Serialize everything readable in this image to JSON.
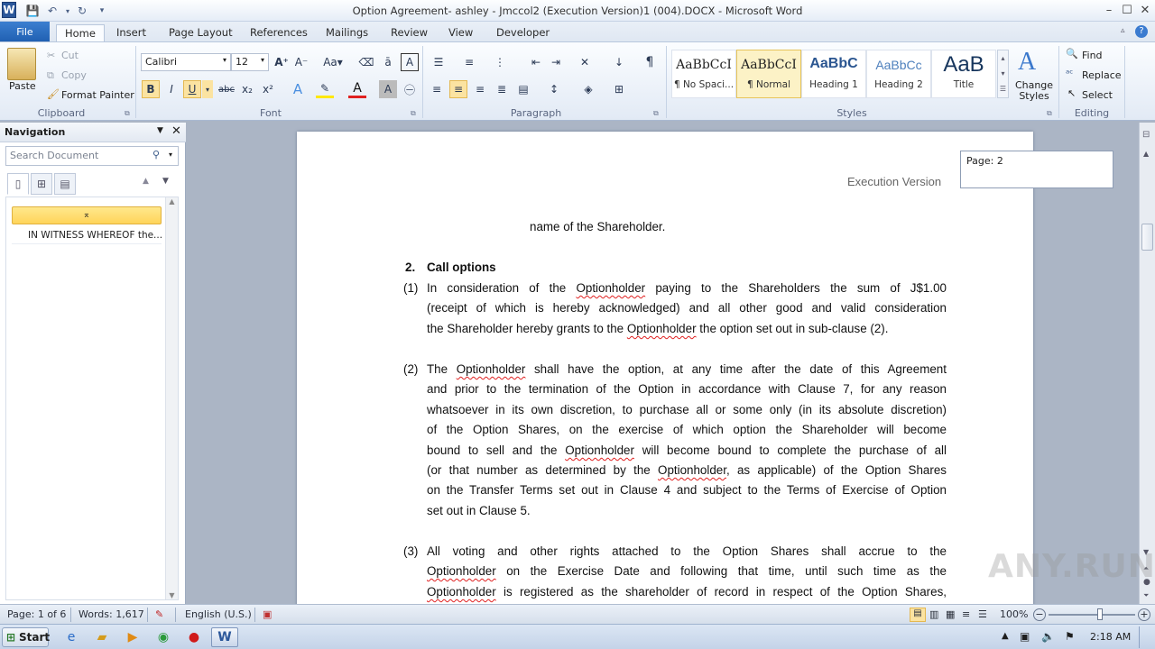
{
  "titlebar": {
    "title": "Option Agreement- ashley - Jmccol2 (Execution Version)1 (004).DOCX  -  Microsoft Word",
    "app_icon": "word-icon",
    "minimize": "–",
    "maximize": "☐",
    "close": "✕"
  },
  "tabs": [
    "File",
    "Home",
    "Insert",
    "Page Layout",
    "References",
    "Mailings",
    "Review",
    "View",
    "Developer"
  ],
  "clipboard": {
    "paste": "Paste",
    "cut": "Cut",
    "copy": "Copy",
    "format_painter": "Format Painter",
    "label": "Clipboard"
  },
  "font": {
    "name": "Calibri",
    "size": "12",
    "label": "Font",
    "bold": "B",
    "italic": "I",
    "underline": "U",
    "strike": "abc",
    "subscript": "x₂",
    "superscript": "x²"
  },
  "paragraph": {
    "label": "Paragraph",
    "pilcrow": "¶"
  },
  "styles": {
    "label": "Styles",
    "items": [
      {
        "preview": "AaBbCcI",
        "name": "¶ No Spaci..."
      },
      {
        "preview": "AaBbCcI",
        "name": "¶ Normal"
      },
      {
        "preview": "AaBbC",
        "name": "Heading 1"
      },
      {
        "preview": "AaBbCc",
        "name": "Heading 2"
      },
      {
        "preview": "AaB",
        "name": "Title"
      }
    ],
    "change_styles": "Change Styles"
  },
  "editing": {
    "label": "Editing",
    "find": "Find",
    "replace": "Replace",
    "select": "Select"
  },
  "nav": {
    "title": "Navigation",
    "search_placeholder": "Search Document",
    "item": "IN WITNESS WHEREOF the..."
  },
  "doc": {
    "header": "Execution Version",
    "line0": "name of the Shareholder.",
    "heading_num": "2.",
    "heading": "Call options",
    "p1_num": "(1)",
    "p1": [
      "In consideration of the",
      "Optionholder",
      "paying to the Shareholders the sum of J$1.00",
      "(receipt of which is hereby acknowledged) and all other good and valid consideration",
      "the Shareholder hereby grants to the",
      "Optionholder",
      "the option set out in sub-clause (2)."
    ],
    "p2_num": "(2)",
    "p2": [
      "The",
      "Optionholder",
      "shall have the option, at any time after the date of this Agreement",
      "and prior to the termination of the Option in accordance with Clause 7, for any reason",
      "whatsoever in its own discretion, to purchase all or some only (in its absolute discretion)",
      "of the Option Shares, on the exercise of which option the Shareholder will become",
      "bound to sell and the",
      "Optionholder",
      "will become bound to complete the purchase of all",
      "(or that number as determined by the",
      "Optionholder",
      ", as applicable) of the Option Shares",
      "on the Transfer Terms set out in Clause 4 and subject to the Terms of Exercise of Option",
      "set out in Clause 5."
    ],
    "p3_num": "(3)",
    "p3": [
      "All voting and other rights attached to the Option Shares shall accrue to the",
      "Optionholder",
      "on the Exercise Date and following that time, until such time as the",
      "Optionholder",
      "is registered as the shareholder of record in respect of the Option Shares,"
    ]
  },
  "page_tip": "Page: 2",
  "status": {
    "page": "Page: 1 of 6",
    "words": "Words: 1,617",
    "language": "English (U.S.)",
    "zoom": "100%",
    "zoom_level": 1.0
  },
  "taskbar": {
    "start": "Start",
    "clock": "2:18 AM"
  },
  "watermark": "ANY.RUN"
}
